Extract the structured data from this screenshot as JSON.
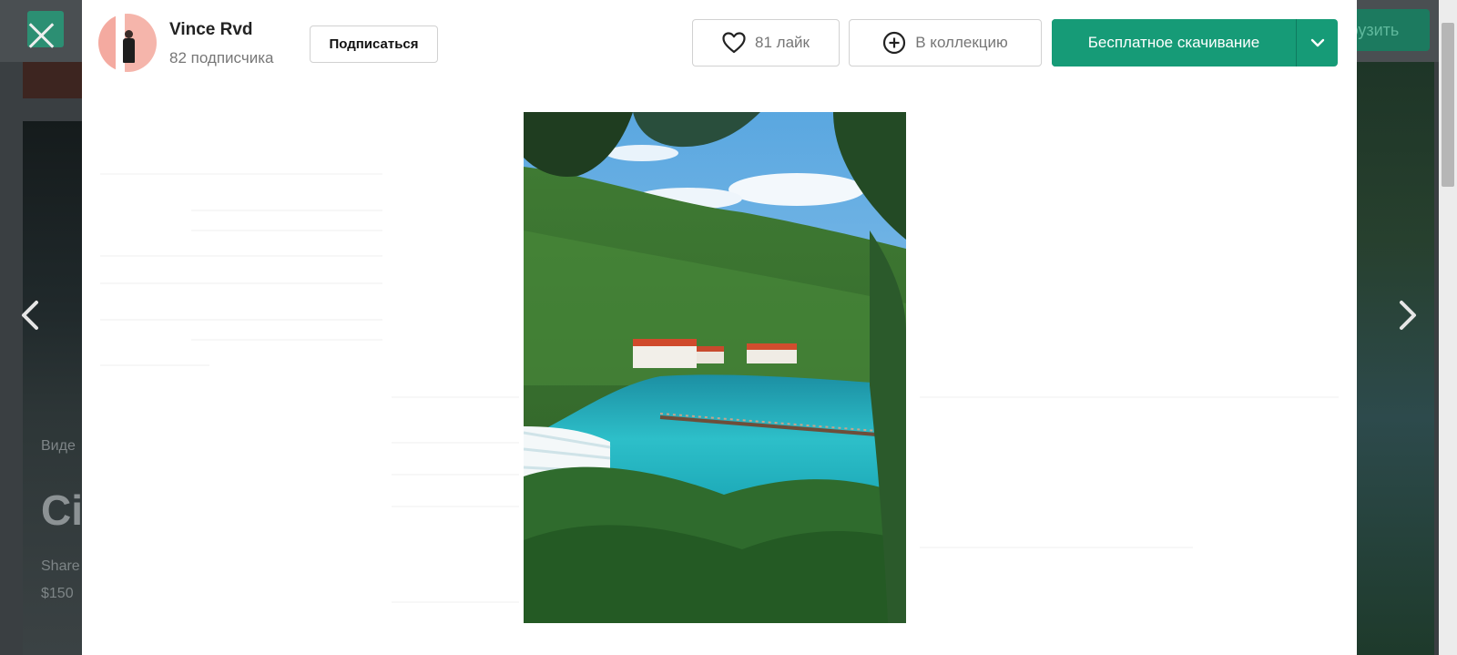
{
  "background_page": {
    "upload_label": "грузить",
    "category_label": "Виде",
    "heading": "Ci",
    "shared_label": "Share",
    "price": "$150"
  },
  "modal": {
    "author": {
      "name": "Vince Rvd",
      "followers": "82 подписчика"
    },
    "subscribe_label": "Подписаться",
    "like_label": "81 лайк",
    "collection_label": "В коллекцию",
    "download_label": "Бесплатное скачивание"
  },
  "icons": {
    "close": "close-icon",
    "prev": "chevron-left-icon",
    "next": "chevron-right-icon",
    "like": "heart-icon",
    "collect": "plus-circle-icon",
    "download_menu": "chevron-down-icon"
  },
  "colors": {
    "download_green": "#169b77",
    "button_border": "#d1d1d1",
    "overlay": "#3a3f42"
  },
  "photo_subject": "Krka waterfalls and turquoise lake framed by green trees"
}
